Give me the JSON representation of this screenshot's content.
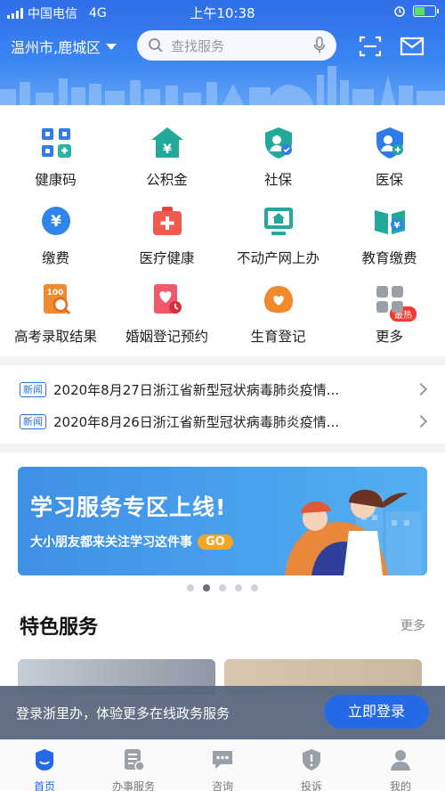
{
  "status_bar": {
    "carrier": "中国电信",
    "network": "4G",
    "time": "上午10:38"
  },
  "header": {
    "city": "温州市,鹿城区",
    "search_placeholder": "查找服务"
  },
  "services": [
    {
      "label": "健康码",
      "icon": "health-code-icon"
    },
    {
      "label": "公积金",
      "icon": "housing-fund-icon"
    },
    {
      "label": "社保",
      "icon": "social-security-icon"
    },
    {
      "label": "医保",
      "icon": "medical-insurance-icon"
    },
    {
      "label": "缴费",
      "icon": "payment-icon"
    },
    {
      "label": "医疗健康",
      "icon": "medical-health-icon"
    },
    {
      "label": "不动产网上办",
      "icon": "real-estate-icon"
    },
    {
      "label": "教育缴费",
      "icon": "education-fee-icon",
      "badge": "最热"
    },
    {
      "label": "高考录取结果",
      "icon": "exam-result-icon"
    },
    {
      "label": "婚姻登记预约",
      "icon": "marriage-registration-icon"
    },
    {
      "label": "生育登记",
      "icon": "birth-registration-icon"
    },
    {
      "label": "更多",
      "icon": "more-grid-icon"
    }
  ],
  "news": [
    {
      "tag": "新闻",
      "text": "2020年8月27日浙江省新型冠状病毒肺炎疫情..."
    },
    {
      "tag": "新闻",
      "text": "2020年8月26日浙江省新型冠状病毒肺炎疫情..."
    }
  ],
  "banner": {
    "title": "学习服务专区上线!",
    "subtitle": "大小朋友都来关注学习这件事",
    "go_label": "GO",
    "active_dot": 2,
    "dot_count": 5
  },
  "featured": {
    "title": "特色服务",
    "more_label": "更多"
  },
  "login_prompt": {
    "text": "登录浙里办，体验更多在线政务服务",
    "button": "立即登录"
  },
  "tabbar": [
    {
      "label": "首页",
      "active": true
    },
    {
      "label": "办事服务",
      "active": false
    },
    {
      "label": "咨询",
      "active": false
    },
    {
      "label": "投诉",
      "active": false
    },
    {
      "label": "我的",
      "active": false
    }
  ],
  "colors": {
    "primary": "#2569e6",
    "header_top": "#2f6ee8",
    "hot_badge": "#f23b30"
  }
}
